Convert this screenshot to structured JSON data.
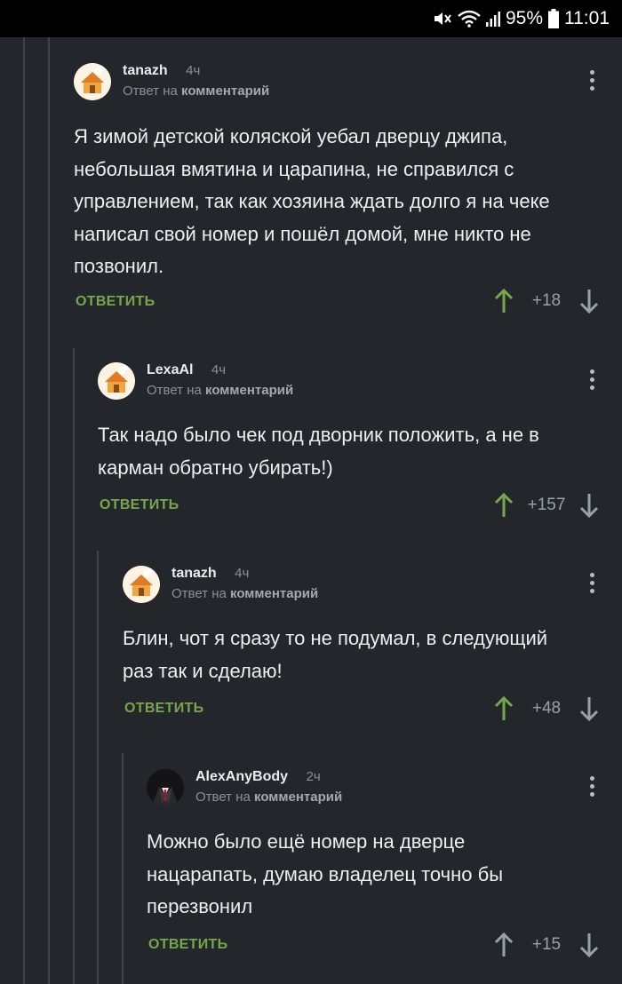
{
  "status_bar": {
    "battery": "95%",
    "time": "11:01"
  },
  "colors": {
    "background": "#23272b",
    "accent_green": "#76a74a",
    "muted": "#8a9196",
    "thread_line": "#3e4448"
  },
  "comments": [
    {
      "author": "tanazh",
      "time": "4ч",
      "reply_prefix": "Ответ на",
      "reply_target": "комментарий",
      "lines": [
        "Я зимой детской коляской уебал дверцу джипа,",
        "небольшая вмятина и царапина, не справился с",
        "управлением, так как хозяина ждать долго я на чеке",
        "написал свой номер и пошёл домой, мне никто не",
        "позвонил."
      ],
      "reply_label": "ОТВЕТИТЬ",
      "score": "+18",
      "upvoted": true,
      "avatar": "cartoon-house-avatar"
    },
    {
      "author": "LexaAl",
      "time": "4ч",
      "reply_prefix": "Ответ на",
      "reply_target": "комментарий",
      "lines": [
        "Так надо было чек под дворник положить, а не в",
        "карман обратно убирать!)"
      ],
      "reply_label": "ОТВЕТИТЬ",
      "score": "+157",
      "upvoted": true,
      "avatar": "cartoon-house-avatar"
    },
    {
      "author": "tanazh",
      "time": "4ч",
      "reply_prefix": "Ответ на",
      "reply_target": "комментарий",
      "lines": [
        "Блин, чот я сразу то не подумал, в следующий",
        "раз так и сделаю!"
      ],
      "reply_label": "ОТВЕТИТЬ",
      "score": "+48",
      "upvoted": true,
      "avatar": "cartoon-house-avatar"
    },
    {
      "author": "AlexAnyBody",
      "time": "2ч",
      "reply_prefix": "Ответ на",
      "reply_target": "комментарий",
      "lines": [
        "Можно было ещё номер на дверце",
        "нацарапать, думаю владелец точно бы",
        "перезвонил"
      ],
      "reply_label": "ОТВЕТИТЬ",
      "score": "+15",
      "upvoted": false,
      "avatar": "suit-man-avatar"
    }
  ]
}
